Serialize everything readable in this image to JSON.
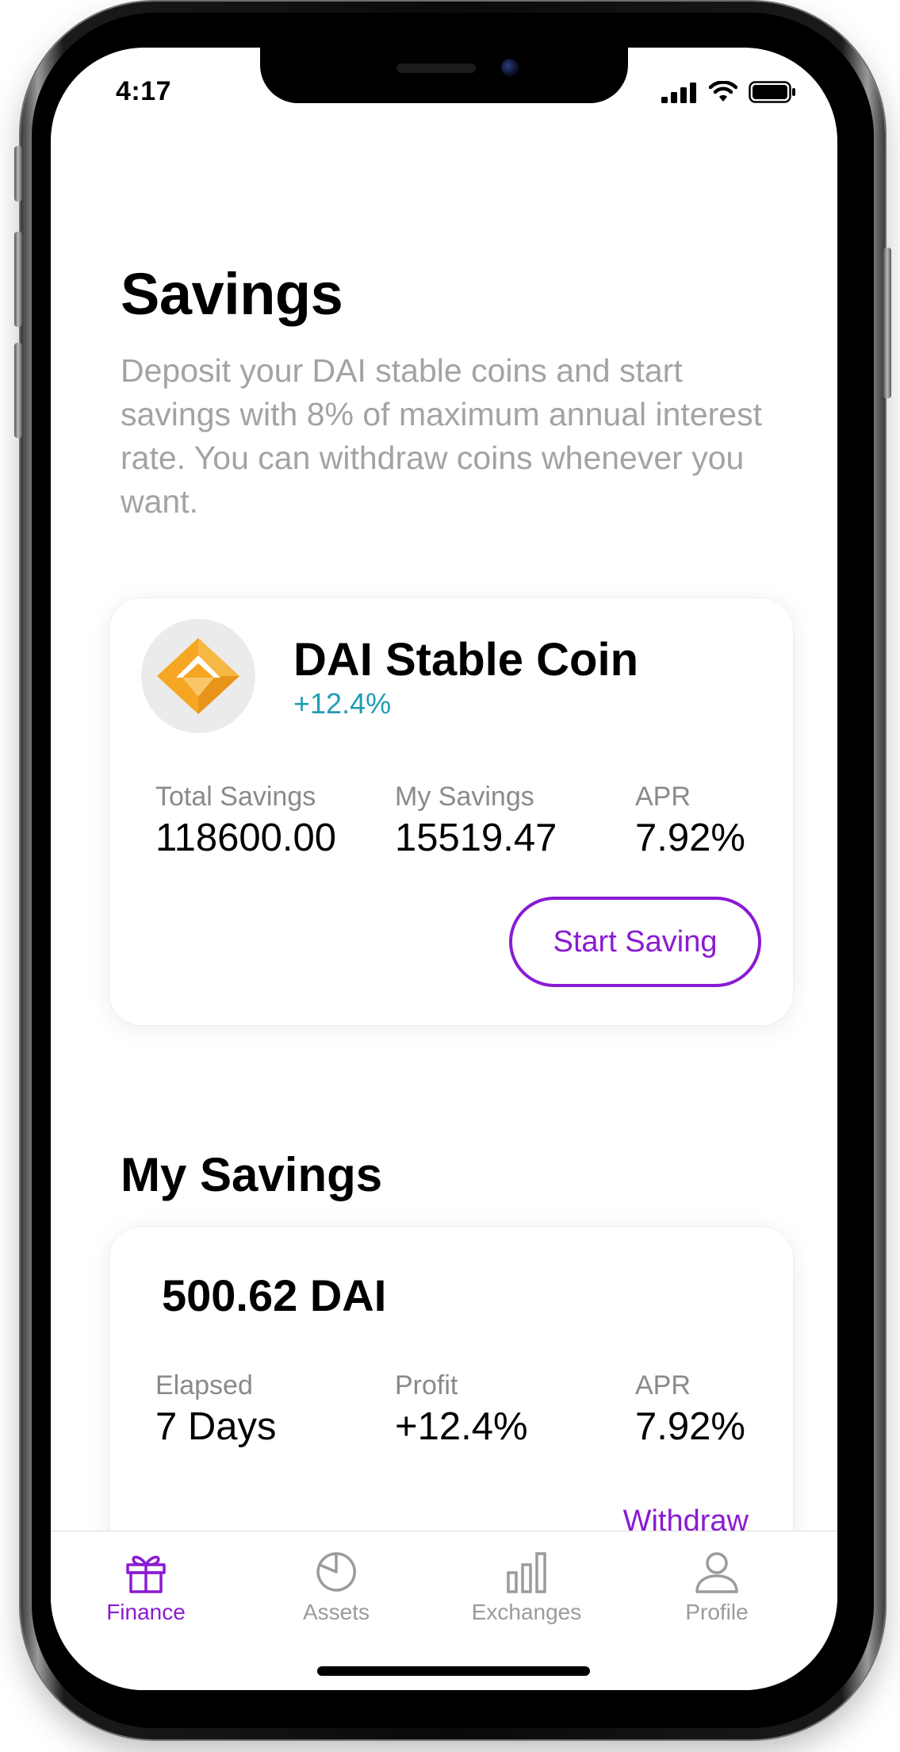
{
  "status_bar": {
    "time": "4:17"
  },
  "page": {
    "title": "Savings",
    "description": "Deposit your DAI stable coins and start savings with 8% of maximum annual interest rate. You can withdraw coins whenever you want."
  },
  "coin_card": {
    "icon": "dai-diamond-icon",
    "name": "DAI Stable Coin",
    "change": "+12.4%",
    "stats": [
      {
        "label": "Total Savings",
        "value": "118600.00"
      },
      {
        "label": "My Savings",
        "value": "15519.47"
      },
      {
        "label": "APR",
        "value": "7.92%"
      }
    ],
    "button_label": "Start Saving"
  },
  "my_savings": {
    "title": "My Savings",
    "item": {
      "amount": "500.62 DAI",
      "stats": [
        {
          "label": "Elapsed",
          "value": "7 Days"
        },
        {
          "label": "Profit",
          "value": "+12.4%"
        },
        {
          "label": "APR",
          "value": "7.92%"
        }
      ],
      "action_label": "Withdraw"
    }
  },
  "tabbar": {
    "tabs": [
      {
        "label": "Finance",
        "icon": "gift-icon",
        "active": true
      },
      {
        "label": "Assets",
        "icon": "pie-chart-icon",
        "active": false
      },
      {
        "label": "Exchanges",
        "icon": "bar-chart-icon",
        "active": false
      },
      {
        "label": "Profile",
        "icon": "user-icon",
        "active": false
      }
    ]
  },
  "colors": {
    "accent": "#8a1bd2",
    "positive": "#1e9db3",
    "muted_text": "#a3a3a3",
    "coin_gold": "#f5a623"
  }
}
